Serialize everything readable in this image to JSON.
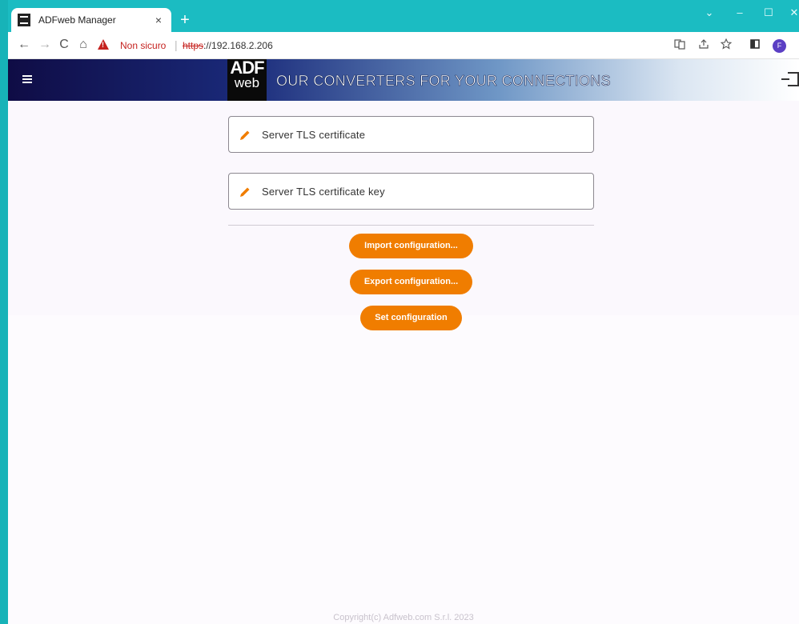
{
  "browser": {
    "tab_title": "ADFweb Manager",
    "tab_close": "×",
    "new_tab": "+",
    "window_controls": [
      "⌄",
      "–",
      "☐",
      "✕"
    ],
    "nav_back": "←",
    "nav_forward": "→",
    "nav_reload": "C",
    "nav_home": "⌂",
    "security_label": "Non sicuro",
    "url_separator": "|",
    "url_protocol": "https",
    "url_rest": "://192.168.2.206",
    "profile_initial": "F",
    "icons": [
      "translate-icon",
      "share-icon",
      "bookmark-star-icon",
      "side-panel-icon",
      "profile-avatar"
    ]
  },
  "header": {
    "logo_top": "ADF",
    "logo_bottom": "web",
    "slogan": "OUR CONVERTERS FOR YOUR CONNECTIONS",
    "accent_color": "#f07d00"
  },
  "fields": [
    {
      "label": "Server TLS certificate"
    },
    {
      "label": "Server TLS certificate key"
    }
  ],
  "buttons": {
    "import": "Import configuration...",
    "export": "Export configuration...",
    "set": "Set configuration"
  },
  "footer": {
    "copyright": "Copyright(c) Adfweb.com S.r.l. 2023"
  }
}
